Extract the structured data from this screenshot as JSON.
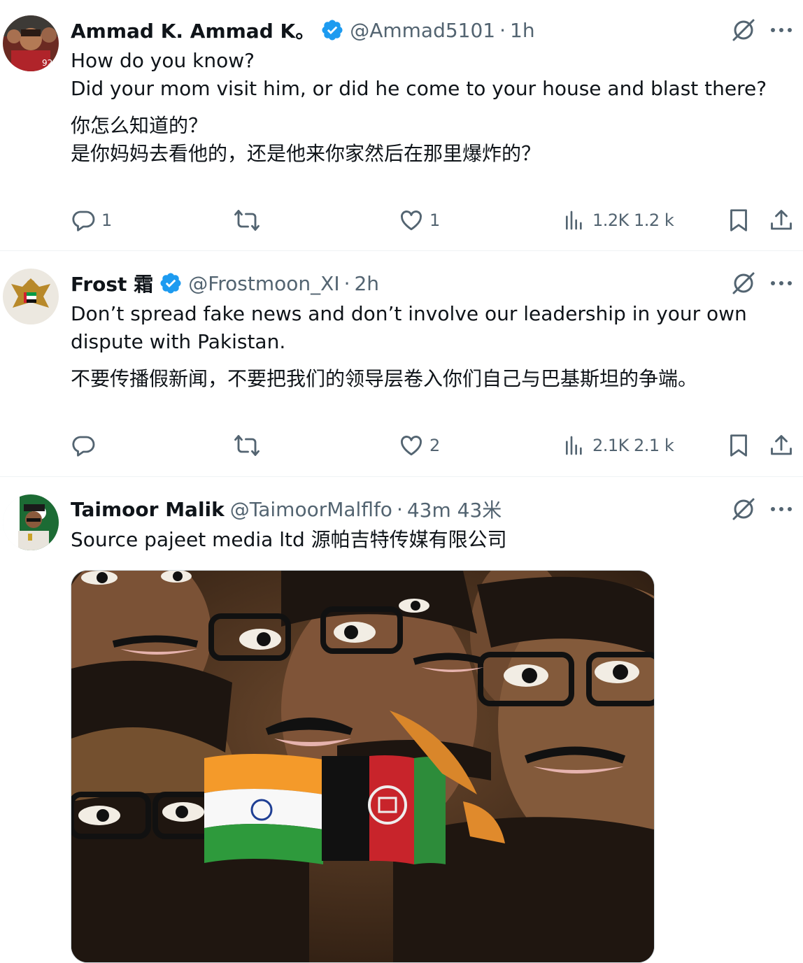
{
  "tweets": [
    {
      "display_name": "Ammad K. Ammad K。",
      "handle": "@Ammad5101",
      "separator": "·",
      "time": "1h",
      "text": "How do you know?\nDid your mom visit him, or did he come to your house and blast there?",
      "translation": "你怎么知道的？\n是你妈妈去看他的，还是他来你家然后在那里爆炸的？",
      "replies": "1",
      "reposts": "",
      "likes": "1",
      "views": "1.2K 1.2 k",
      "verified": true
    },
    {
      "display_name": "Frost 霜",
      "handle": "@Frostmoon_XI",
      "separator": "·",
      "time": "2h",
      "text": "Don’t spread fake news and don’t involve our leadership in your own\ndispute with Pakistan.",
      "translation": "不要传播假新闻，不要把我们的领导层卷入你们自己与巴基斯坦的争端。",
      "replies": "",
      "reposts": "",
      "likes": "2",
      "views": "2.1K 2.1 k",
      "verified": true
    },
    {
      "display_name": "Taimoor Malik",
      "handle": "@TaimoorMalflfo",
      "separator": "·",
      "time": "43m 43米",
      "text": "Source pajeet media ltd   源帕吉特传媒有限公司",
      "verified": false
    }
  ],
  "icons": {
    "verified": "verified-badge-icon",
    "grok": "grok-icon",
    "more": "more-icon",
    "reply": "reply-icon",
    "repost": "repost-icon",
    "like": "like-icon",
    "views": "views-icon",
    "bookmark": "bookmark-icon",
    "share": "share-icon"
  },
  "colors": {
    "verified_blue": "#1d9bf0",
    "text_primary": "#0f1419",
    "text_secondary": "#536471",
    "divider": "#eff3f4"
  }
}
